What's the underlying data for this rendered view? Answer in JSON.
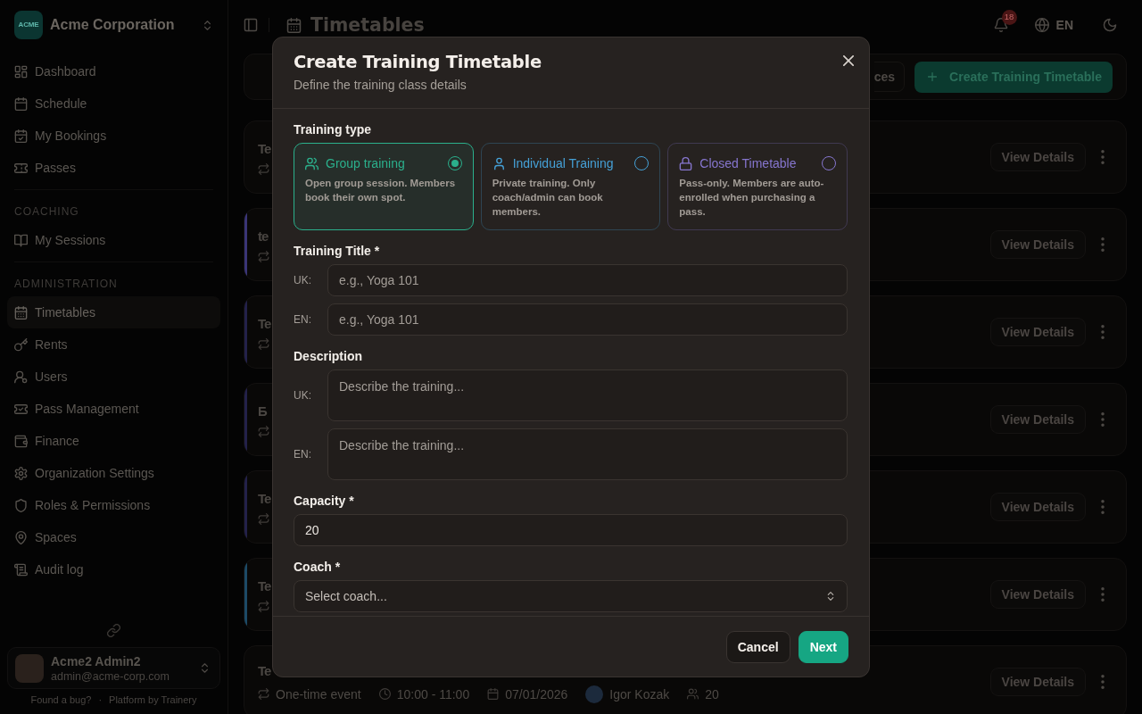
{
  "sidebar": {
    "org_name": "Acme Corporation",
    "logo_text": "ACME",
    "sections": [
      {
        "items": [
          {
            "label": "Dashboard",
            "selected": false
          },
          {
            "label": "Schedule",
            "selected": false
          },
          {
            "label": "My Bookings",
            "selected": false
          },
          {
            "label": "Passes",
            "selected": false
          }
        ]
      },
      {
        "heading": "COACHING",
        "items": [
          {
            "label": "My Sessions",
            "selected": false
          }
        ]
      },
      {
        "heading": "ADMINISTRATION",
        "items": [
          {
            "label": "Timetables",
            "selected": true
          },
          {
            "label": "Rents",
            "selected": false
          },
          {
            "label": "Users",
            "selected": false
          },
          {
            "label": "Pass Management",
            "selected": false
          },
          {
            "label": "Finance",
            "selected": false
          },
          {
            "label": "Organization Settings",
            "selected": false
          },
          {
            "label": "Roles & Permissions",
            "selected": false
          },
          {
            "label": "Spaces",
            "selected": false
          },
          {
            "label": "Audit log",
            "selected": false
          }
        ]
      }
    ],
    "user": {
      "name": "Acme2 Admin2",
      "email": "admin@acme-corp.com"
    },
    "footer": {
      "bug_link": "Found a bug?",
      "separator": "·",
      "credit": "Platform by Trainery"
    }
  },
  "header": {
    "title": "Timetables",
    "notifications": "18",
    "language": "EN"
  },
  "toolbar": {
    "buttons": [
      {
        "label": "ces",
        "kind": "secondary"
      },
      {
        "label": "Create Training Timetable",
        "kind": "primary"
      }
    ]
  },
  "timetables": [
    {
      "title": "Te",
      "action": "View Details"
    },
    {
      "title": "te",
      "color": "#3a3577",
      "action": "View Details"
    },
    {
      "title": "Te",
      "color": "#23214a",
      "action": "View Details"
    },
    {
      "title": "Б",
      "color": "#23214a",
      "action": "View Details"
    },
    {
      "title": "Te",
      "color": "#23214a",
      "action": "View Details"
    },
    {
      "title": "Te",
      "color": "#1c4a66",
      "action": "View Details"
    },
    {
      "title": "Te",
      "action": "View Details",
      "meta": {
        "recurrence": "One-time event",
        "time": "10:00 - 11:00",
        "date": "07/01/2026",
        "coach": "Igor Kozak",
        "capacity": "20"
      }
    }
  ],
  "modal": {
    "title": "Create Training Timetable",
    "subtitle": "Define the training class details",
    "training_type_label": "Training type",
    "training_types": [
      {
        "label": "Group training",
        "description": "Open group session. Members book their own spot.",
        "selected": true,
        "color": "#2bb08c"
      },
      {
        "label": "Individual Training",
        "description": "Private training. Only coach/admin can book members.",
        "selected": false,
        "color": "#45a0d6"
      },
      {
        "label": "Closed Timetable",
        "description": "Pass-only. Members are auto-enrolled when purchasing a pass.",
        "selected": false,
        "color": "#8676cf"
      }
    ],
    "title_label": "Training Title *",
    "title_fields": [
      {
        "language": "UK:",
        "placeholder": "e.g., Yoga 101"
      },
      {
        "language": "EN:",
        "placeholder": "e.g., Yoga 101"
      }
    ],
    "description_label": "Description",
    "description_fields": [
      {
        "language": "UK:",
        "placeholder": "Describe the training..."
      },
      {
        "language": "EN:",
        "placeholder": "Describe the training..."
      }
    ],
    "capacity_label": "Capacity *",
    "capacity_value": "20",
    "coach_label": "Coach *",
    "coach_placeholder": "Select coach...",
    "buttons": [
      {
        "label": "Cancel",
        "kind": "secondary"
      },
      {
        "label": "Next",
        "kind": "primary"
      }
    ]
  }
}
